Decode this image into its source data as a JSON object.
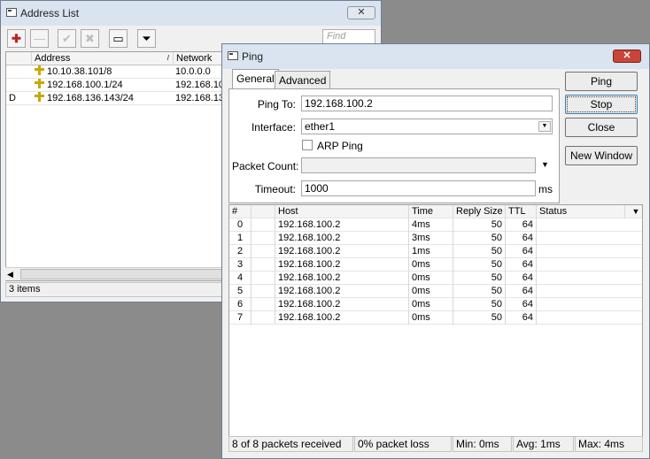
{
  "address_list": {
    "title": "Address List",
    "close_label": "✕",
    "find_placeholder": "Find",
    "toolbar": [
      {
        "name": "add-button",
        "glyph": "✚",
        "enabled": true
      },
      {
        "name": "remove-button",
        "glyph": "—",
        "enabled": false
      },
      {
        "name": "enable-button",
        "glyph": "✔",
        "enabled": false
      },
      {
        "name": "disable-button",
        "glyph": "✖",
        "enabled": false
      },
      {
        "name": "comment-button",
        "glyph": "▭",
        "enabled": true
      },
      {
        "name": "filter-button",
        "glyph": "⏷",
        "enabled": true
      }
    ],
    "columns": [
      "Address",
      "Network"
    ],
    "rows": [
      {
        "flag": "",
        "address": "10.10.38.101/8",
        "network": "10.0.0.0"
      },
      {
        "flag": "",
        "address": "192.168.100.1/24",
        "network": "192.168.10"
      },
      {
        "flag": "D",
        "address": "192.168.136.143/24",
        "network": "192.168.13"
      }
    ],
    "status": "3 items"
  },
  "ping": {
    "title": "Ping",
    "close_label": "✕",
    "tabs": [
      "General",
      "Advanced"
    ],
    "fields": {
      "ping_to_label": "Ping To:",
      "ping_to_value": "192.168.100.2",
      "interface_label": "Interface:",
      "interface_value": "ether1",
      "arp_ping_label": "ARP Ping",
      "packet_count_label": "Packet Count:",
      "packet_count_value": "",
      "timeout_label": "Timeout:",
      "timeout_value": "1000",
      "timeout_unit": "ms"
    },
    "buttons": [
      "Ping",
      "Stop",
      "Close",
      "New Window"
    ],
    "columns": [
      "#",
      "Host",
      "Time",
      "Reply Size",
      "TTL",
      "Status"
    ],
    "results": [
      {
        "n": "0",
        "host": "192.168.100.2",
        "time": "4ms",
        "size": "50",
        "ttl": "64",
        "status": ""
      },
      {
        "n": "1",
        "host": "192.168.100.2",
        "time": "3ms",
        "size": "50",
        "ttl": "64",
        "status": ""
      },
      {
        "n": "2",
        "host": "192.168.100.2",
        "time": "1ms",
        "size": "50",
        "ttl": "64",
        "status": ""
      },
      {
        "n": "3",
        "host": "192.168.100.2",
        "time": "0ms",
        "size": "50",
        "ttl": "64",
        "status": ""
      },
      {
        "n": "4",
        "host": "192.168.100.2",
        "time": "0ms",
        "size": "50",
        "ttl": "64",
        "status": ""
      },
      {
        "n": "5",
        "host": "192.168.100.2",
        "time": "0ms",
        "size": "50",
        "ttl": "64",
        "status": ""
      },
      {
        "n": "6",
        "host": "192.168.100.2",
        "time": "0ms",
        "size": "50",
        "ttl": "64",
        "status": ""
      },
      {
        "n": "7",
        "host": "192.168.100.2",
        "time": "0ms",
        "size": "50",
        "ttl": "64",
        "status": ""
      }
    ],
    "status": {
      "received": "8 of 8 packets received",
      "loss": "0% packet loss",
      "min": "Min: 0ms",
      "avg": "Avg: 1ms",
      "max": "Max: 4ms"
    }
  },
  "colors": {
    "add_icon": "#c0201a",
    "ip_icon": "#c9a800"
  }
}
